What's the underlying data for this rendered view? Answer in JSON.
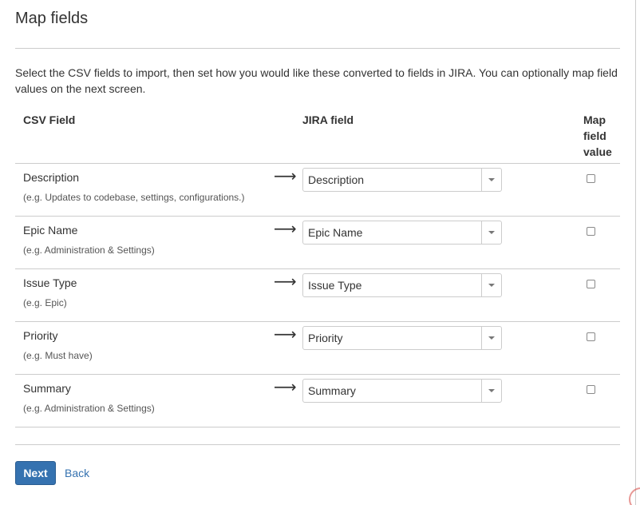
{
  "page": {
    "title": "Map fields",
    "intro": "Select the CSV fields to import, then set how you would like these converted to fields in JIRA. You can optionally map field values on the next screen."
  },
  "table": {
    "headers": {
      "csv_field": "CSV Field",
      "jira_field": "JIRA field",
      "map_value": "Map field value"
    },
    "arrow_glyph": "⟶",
    "rows": [
      {
        "csv_name": "Description",
        "example": "(e.g. Updates to codebase, settings, configurations.)",
        "jira_value": "Description",
        "map_checked": false
      },
      {
        "csv_name": "Epic Name",
        "example": "(e.g. Administration & Settings)",
        "jira_value": "Epic Name",
        "map_checked": false
      },
      {
        "csv_name": "Issue Type",
        "example": "(e.g. Epic)",
        "jira_value": "Issue Type",
        "map_checked": false
      },
      {
        "csv_name": "Priority",
        "example": "(e.g. Must have)",
        "jira_value": "Priority",
        "map_checked": false
      },
      {
        "csv_name": "Summary",
        "example": "(e.g. Administration & Settings)",
        "jira_value": "Summary",
        "map_checked": false
      }
    ]
  },
  "actions": {
    "next_label": "Next",
    "back_label": "Back"
  },
  "colors": {
    "primary": "#3572b0",
    "border": "#cccccc",
    "text": "#333333"
  }
}
